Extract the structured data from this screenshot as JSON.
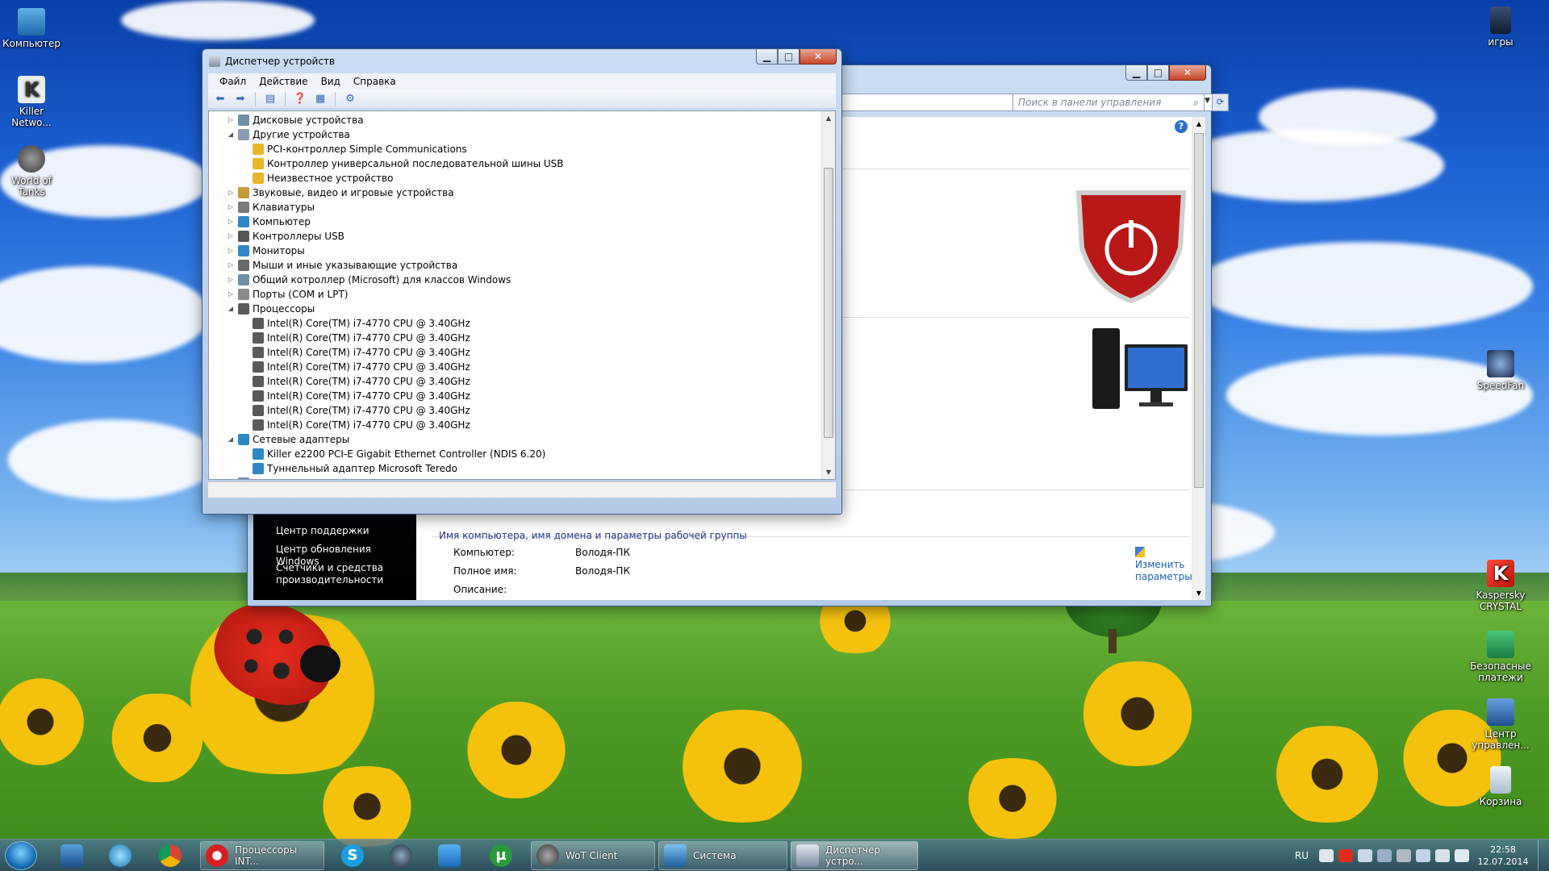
{
  "desktop": {
    "icons_left": [
      {
        "label": "Компьютер",
        "icon": "computer-icon",
        "color": "#2f7fb8"
      },
      {
        "label": "Killer Netwo...",
        "icon": "killer-network-icon",
        "color": "#e9eef3"
      },
      {
        "label": "World of Tanks",
        "icon": "world-of-tanks-icon",
        "color": "#5a5a5a"
      }
    ],
    "icons_right": [
      {
        "label": "игры",
        "icon": "folder-icon",
        "color": "#1f2f4a"
      },
      {
        "label": "SpeedFan",
        "icon": "speedfan-icon",
        "color": "#1c2a4c"
      },
      {
        "label": "Kaspersky CRYSTAL",
        "icon": "kaspersky-icon",
        "color": "#e02a20"
      },
      {
        "label": "Безопасные платежи",
        "icon": "safe-money-icon",
        "color": "#2a9a5a"
      },
      {
        "label": "Центр управлен...",
        "icon": "control-center-icon",
        "color": "#2a5a9a"
      },
      {
        "label": "Корзина",
        "icon": "recycle-bin-icon",
        "color": "#b8c8d8"
      }
    ]
  },
  "control_panel": {
    "search_placeholder": "Поиск в панели управления",
    "left_links": [
      "Центр поддержки",
      "Центр обновления Windows",
      "Счетчики и средства производительности"
    ],
    "section_title": "Имя компьютера, имя домена и параметры рабочей группы",
    "rows": [
      {
        "label": "Компьютер:",
        "value": "Володя-ПК"
      },
      {
        "label": "Полное имя:",
        "value": "Володя-ПК"
      },
      {
        "label": "Описание:",
        "value": ""
      }
    ],
    "change_link": "Изменить параметры"
  },
  "device_manager": {
    "title": "Диспетчер устройств",
    "menu": [
      "Файл",
      "Действие",
      "Вид",
      "Справка"
    ],
    "tree": [
      {
        "level": 1,
        "expander": "collapsed",
        "label": "Дисковые устройства",
        "icon_color": "#6f8fa8"
      },
      {
        "level": 1,
        "expander": "expanded",
        "label": "Другие устройства",
        "icon_color": "#8a9bb3"
      },
      {
        "level": 2,
        "expander": "none",
        "label": "PCI-контроллер Simple Communications",
        "icon_color": "#e7b62a"
      },
      {
        "level": 2,
        "expander": "none",
        "label": "Контроллер универсальной последовательной шины USB",
        "icon_color": "#e7b62a"
      },
      {
        "level": 2,
        "expander": "none",
        "label": "Неизвестное устройство",
        "icon_color": "#e7b62a"
      },
      {
        "level": 1,
        "expander": "collapsed",
        "label": "Звуковые, видео и игровые устройства",
        "icon_color": "#c89a3a"
      },
      {
        "level": 1,
        "expander": "collapsed",
        "label": "Клавиатуры",
        "icon_color": "#7a7a7a"
      },
      {
        "level": 1,
        "expander": "collapsed",
        "label": "Компьютер",
        "icon_color": "#2f86c4"
      },
      {
        "level": 1,
        "expander": "collapsed",
        "label": "Контроллеры USB",
        "icon_color": "#555555"
      },
      {
        "level": 1,
        "expander": "collapsed",
        "label": "Мониторы",
        "icon_color": "#2f86c4"
      },
      {
        "level": 1,
        "expander": "collapsed",
        "label": "Мыши и иные указывающие устройства",
        "icon_color": "#6a6a6a"
      },
      {
        "level": 1,
        "expander": "collapsed",
        "label": "Общий котроллер (Microsoft) для классов Windows",
        "icon_color": "#6f8fa8"
      },
      {
        "level": 1,
        "expander": "collapsed",
        "label": "Порты (COM и LPT)",
        "icon_color": "#8a8a8a"
      },
      {
        "level": 1,
        "expander": "expanded",
        "label": "Процессоры",
        "icon_color": "#5a5a5a"
      },
      {
        "level": 2,
        "expander": "none",
        "label": "Intel(R) Core(TM) i7-4770 CPU @ 3.40GHz",
        "icon_color": "#5a5a5a"
      },
      {
        "level": 2,
        "expander": "none",
        "label": "Intel(R) Core(TM) i7-4770 CPU @ 3.40GHz",
        "icon_color": "#5a5a5a"
      },
      {
        "level": 2,
        "expander": "none",
        "label": "Intel(R) Core(TM) i7-4770 CPU @ 3.40GHz",
        "icon_color": "#5a5a5a"
      },
      {
        "level": 2,
        "expander": "none",
        "label": "Intel(R) Core(TM) i7-4770 CPU @ 3.40GHz",
        "icon_color": "#5a5a5a"
      },
      {
        "level": 2,
        "expander": "none",
        "label": "Intel(R) Core(TM) i7-4770 CPU @ 3.40GHz",
        "icon_color": "#5a5a5a"
      },
      {
        "level": 2,
        "expander": "none",
        "label": "Intel(R) Core(TM) i7-4770 CPU @ 3.40GHz",
        "icon_color": "#5a5a5a"
      },
      {
        "level": 2,
        "expander": "none",
        "label": "Intel(R) Core(TM) i7-4770 CPU @ 3.40GHz",
        "icon_color": "#5a5a5a"
      },
      {
        "level": 2,
        "expander": "none",
        "label": "Intel(R) Core(TM) i7-4770 CPU @ 3.40GHz",
        "icon_color": "#5a5a5a"
      },
      {
        "level": 1,
        "expander": "expanded",
        "label": "Сетевые адаптеры",
        "icon_color": "#2f86c4"
      },
      {
        "level": 2,
        "expander": "none",
        "label": "Killer e2200 PCI-E Gigabit Ethernet Controller (NDIS 6.20)",
        "icon_color": "#2f86c4"
      },
      {
        "level": 2,
        "expander": "none",
        "label": "Туннельный адаптер Microsoft Teredo",
        "icon_color": "#2f86c4"
      },
      {
        "level": 1,
        "expander": "collapsed",
        "label": "Системные устройства",
        "icon_color": "#6f8fa8"
      }
    ]
  },
  "taskbar": {
    "pinned": [
      {
        "icon": "display-manager-icon",
        "color": "#2b6fb2"
      },
      {
        "icon": "media-center-icon",
        "color": "#3aa0d8"
      },
      {
        "icon": "chrome-icon",
        "color": "#e0b52a"
      }
    ],
    "tasks": [
      {
        "label": "Процессоры INT...",
        "icon": "opera-icon",
        "color": "#d81e1e",
        "active": false
      },
      {
        "label": "",
        "icon": "skype-icon",
        "color": "#1a9ee0",
        "active": false
      },
      {
        "label": "",
        "icon": "steam-icon",
        "color": "#1b2838",
        "active": false
      },
      {
        "label": "",
        "icon": "uplay-icon",
        "color": "#2a8ad8",
        "active": false
      },
      {
        "label": "",
        "icon": "utorrent-icon",
        "color": "#2a9a3a",
        "active": false
      },
      {
        "label": "WoT Client",
        "icon": "world-of-tanks-icon",
        "color": "#4a4a4a",
        "active": false
      },
      {
        "label": "Система",
        "icon": "system-icon",
        "color": "#3a8fd0",
        "active": false
      },
      {
        "label": "Диспетчер устро...",
        "icon": "device-manager-icon",
        "color": "#8a9bb3",
        "active": true
      }
    ],
    "language": "RU",
    "time": "22:58",
    "date": "12.07.2014"
  }
}
